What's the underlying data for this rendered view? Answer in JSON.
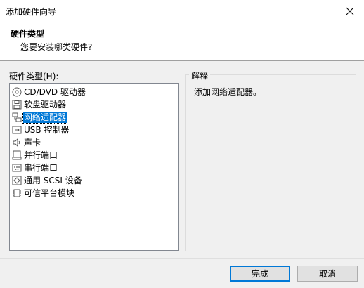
{
  "window": {
    "title": "添加硬件向导",
    "close_icon": "close-icon"
  },
  "header": {
    "title": "硬件类型",
    "subtitle": "您要安装哪类硬件?"
  },
  "hardware_list": {
    "label": "硬件类型(H):",
    "selected": "网络适配器",
    "items": [
      {
        "label": "CD/DVD 驱动器",
        "icon": "cd-dvd-icon"
      },
      {
        "label": "软盘驱动器",
        "icon": "floppy-icon"
      },
      {
        "label": "网络适配器",
        "icon": "network-adapter-icon"
      },
      {
        "label": "USB 控制器",
        "icon": "usb-icon"
      },
      {
        "label": "声卡",
        "icon": "speaker-icon"
      },
      {
        "label": "并行端口",
        "icon": "parallel-port-icon"
      },
      {
        "label": "串行端口",
        "icon": "serial-port-icon"
      },
      {
        "label": "通用 SCSI 设备",
        "icon": "scsi-icon"
      },
      {
        "label": "可信平台模块",
        "icon": "tpm-icon"
      }
    ]
  },
  "explanation": {
    "legend": "解释",
    "text": "添加网络适配器。"
  },
  "buttons": {
    "ok": "完成",
    "cancel": "取消"
  }
}
